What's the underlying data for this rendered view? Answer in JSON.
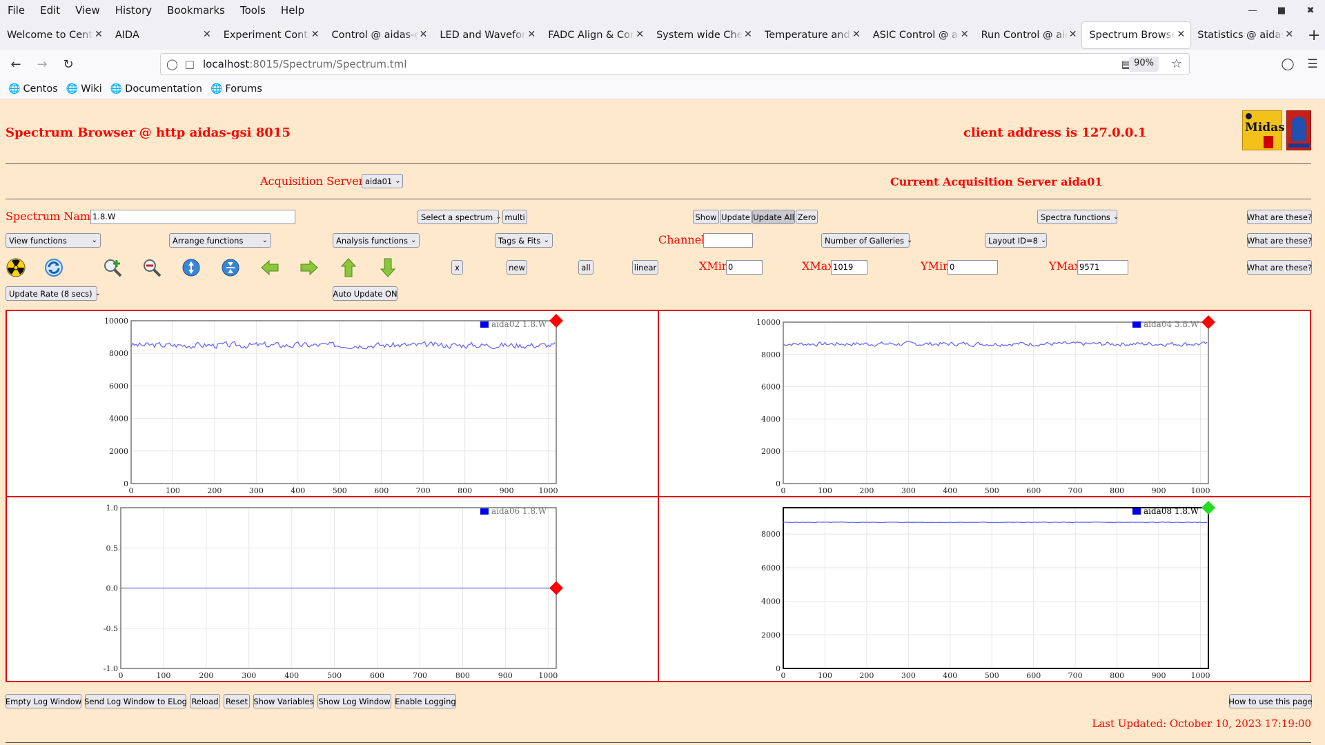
{
  "browser": {
    "menu": [
      "File",
      "Edit",
      "View",
      "History",
      "Bookmarks",
      "Tools",
      "Help"
    ],
    "tabs": [
      {
        "label": "Welcome to CentOS"
      },
      {
        "label": "AIDA"
      },
      {
        "label": "Experiment Control"
      },
      {
        "label": "Control @ aidas-gsi"
      },
      {
        "label": "LED and Waveform"
      },
      {
        "label": "FADC Align & Control"
      },
      {
        "label": "System wide Checks"
      },
      {
        "label": "Temperature and s"
      },
      {
        "label": "ASIC Control @ aidas"
      },
      {
        "label": "Run Control @ aidas"
      },
      {
        "label": "Spectrum Browser"
      },
      {
        "label": "Statistics @ aidas-"
      }
    ],
    "url_host": "localhost",
    "url_rest": ":8015/Spectrum/Spectrum.tml",
    "zoom": "90%",
    "bookmarks": [
      "Centos",
      "Wiki",
      "Documentation",
      "Forums"
    ]
  },
  "page": {
    "title": "Spectrum Browser @ http aidas-gsi 8015",
    "client_address": "client address is 127.0.0.1",
    "acq_servers_label": "Acquisition Servers",
    "acq_server_value": "aida01",
    "current_server": "Current Acquisition Server aida01",
    "spectrum_name_label": "Spectrum Name:",
    "spectrum_name_value": "1.8.W",
    "select_spectrum": "Select a spectrum",
    "multi": "multi",
    "show": "Show",
    "update": "Update",
    "update_all": "Update All",
    "zero": "Zero",
    "spectra_functions": "Spectra functions",
    "what": "What are these?",
    "view_functions": "View functions",
    "arrange_functions": "Arrange functions",
    "analysis_functions": "Analysis functions",
    "tags_fits": "Tags & Fits",
    "channel_label": "Channel:",
    "channel_value": "",
    "num_galleries": "Number of Galleries",
    "layout": "Layout ID=8",
    "x_btn": "x",
    "new_btn": "new",
    "all_btn": "all",
    "linear_btn": "linear",
    "xmin_label": "XMin",
    "xmin": "0",
    "xmax_label": "XMax",
    "xmax": "1019",
    "ymin_label": "YMin",
    "ymin": "0",
    "ymax_label": "YMax",
    "ymax": "9571",
    "update_rate": "Update Rate (8 secs)",
    "auto_update": "Auto Update ON",
    "bottom_buttons": [
      "Empty Log Window",
      "Send Log Window to ELog",
      "Reload",
      "Reset",
      "Show Variables",
      "Show Log Window",
      "Enable Logging"
    ],
    "how_to": "How to use this page",
    "last_updated": "Last Updated: October 10, 2023 17:19:00"
  },
  "colors": {
    "page_bg": "#ffe9cc",
    "accent_red": "#ff0000",
    "line": "#6a6aff",
    "marker_red": "#ff0000",
    "marker_green": "#22dd22"
  },
  "chart_data": [
    {
      "type": "line",
      "legend": "aida02 1.8.W",
      "x_ticks": [
        0,
        100,
        200,
        300,
        400,
        500,
        600,
        700,
        800,
        900,
        1000
      ],
      "y_ticks": [
        0,
        2000,
        4000,
        6000,
        8000,
        10000
      ],
      "xlim": [
        0,
        1019
      ],
      "ylim": [
        0,
        10000
      ],
      "mean": 8500,
      "noise": 260,
      "seed": 3,
      "marker": "red",
      "active": false
    },
    {
      "type": "line",
      "legend": "aida04 3.8.W",
      "x_ticks": [
        0,
        100,
        200,
        300,
        400,
        500,
        600,
        700,
        800,
        900,
        1000
      ],
      "y_ticks": [
        0,
        2000,
        4000,
        6000,
        8000,
        10000
      ],
      "xlim": [
        0,
        1019
      ],
      "ylim": [
        0,
        10000
      ],
      "mean": 8650,
      "noise": 180,
      "seed": 7,
      "marker": "red",
      "active": false
    },
    {
      "type": "line",
      "legend": "aida06 1.8.W",
      "x_ticks": [
        0,
        100,
        200,
        300,
        400,
        500,
        600,
        700,
        800,
        900,
        1000
      ],
      "y_ticks": [
        1.0,
        0.5,
        0.0,
        -0.5,
        -1.0
      ],
      "xlim": [
        0,
        1019
      ],
      "ylim": [
        -1,
        1
      ],
      "mean": 0,
      "noise": 0,
      "seed": 1,
      "marker": "red",
      "active": false
    },
    {
      "type": "line",
      "legend": "aida08 1.8.W",
      "x_ticks": [
        0,
        100,
        200,
        300,
        400,
        500,
        600,
        700,
        800,
        900,
        1000
      ],
      "y_ticks": [
        0,
        2000,
        4000,
        6000,
        8000
      ],
      "xlim": [
        0,
        1019
      ],
      "ylim": [
        0,
        9571
      ],
      "mean": 8700,
      "noise": 20,
      "seed": 5,
      "marker": "green",
      "active": true
    }
  ]
}
